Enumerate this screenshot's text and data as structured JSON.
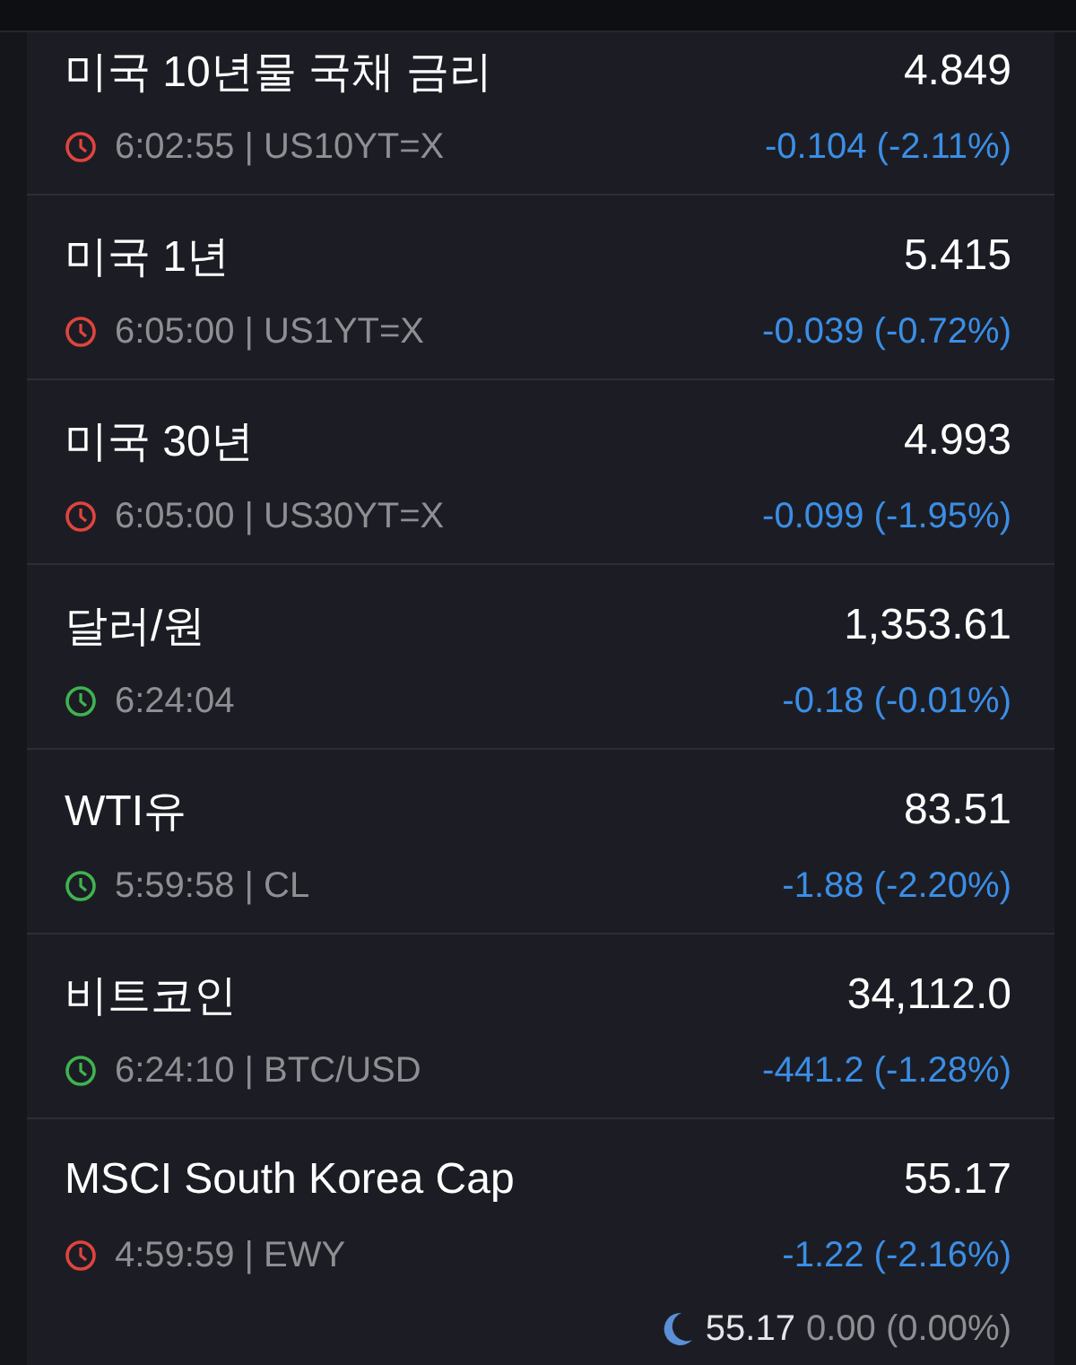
{
  "quotes": [
    {
      "name": "미국 10년물 국채 금리",
      "price": "4.849",
      "market_open": false,
      "quote_time": "6:02:55 | US10YT=X",
      "change": "-0.104 (-2.11%)",
      "color": "#3b8ee6"
    },
    {
      "name": "미국 1년",
      "price": "5.415",
      "market_open": false,
      "quote_time": "6:05:00 | US1YT=X",
      "change": "-0.039 (-0.72%)",
      "color": "#3b8ee6"
    },
    {
      "name": "미국 30년",
      "price": "4.993",
      "market_open": false,
      "quote_time": "6:05:00 | US30YT=X",
      "change": "-0.099 (-1.95%)",
      "color": "#3b8ee6"
    },
    {
      "name": "달러/원",
      "price": "1,353.61",
      "market_open": true,
      "quote_time": "6:24:04",
      "change": "-0.18 (-0.01%)",
      "color": "#3b8ee6"
    },
    {
      "name": "WTI유",
      "price": "83.51",
      "market_open": true,
      "quote_time": "5:59:58 | CL",
      "change": "-1.88 (-2.20%)",
      "color": "#3b8ee6"
    },
    {
      "name": "비트코인",
      "price": "34,112.0",
      "market_open": true,
      "quote_time": "6:24:10 | BTC/USD",
      "change": "-441.2 (-1.28%)",
      "color": "#3b8ee6"
    },
    {
      "name": "MSCI South Korea Cap",
      "price": "55.17",
      "market_open": false,
      "quote_time": "4:59:59 | EWY",
      "change": "-1.22 (-2.16%)",
      "color": "#3b8ee6",
      "after_hours": {
        "price": "55.17",
        "change": "0.00 (0.00%)"
      }
    }
  ]
}
